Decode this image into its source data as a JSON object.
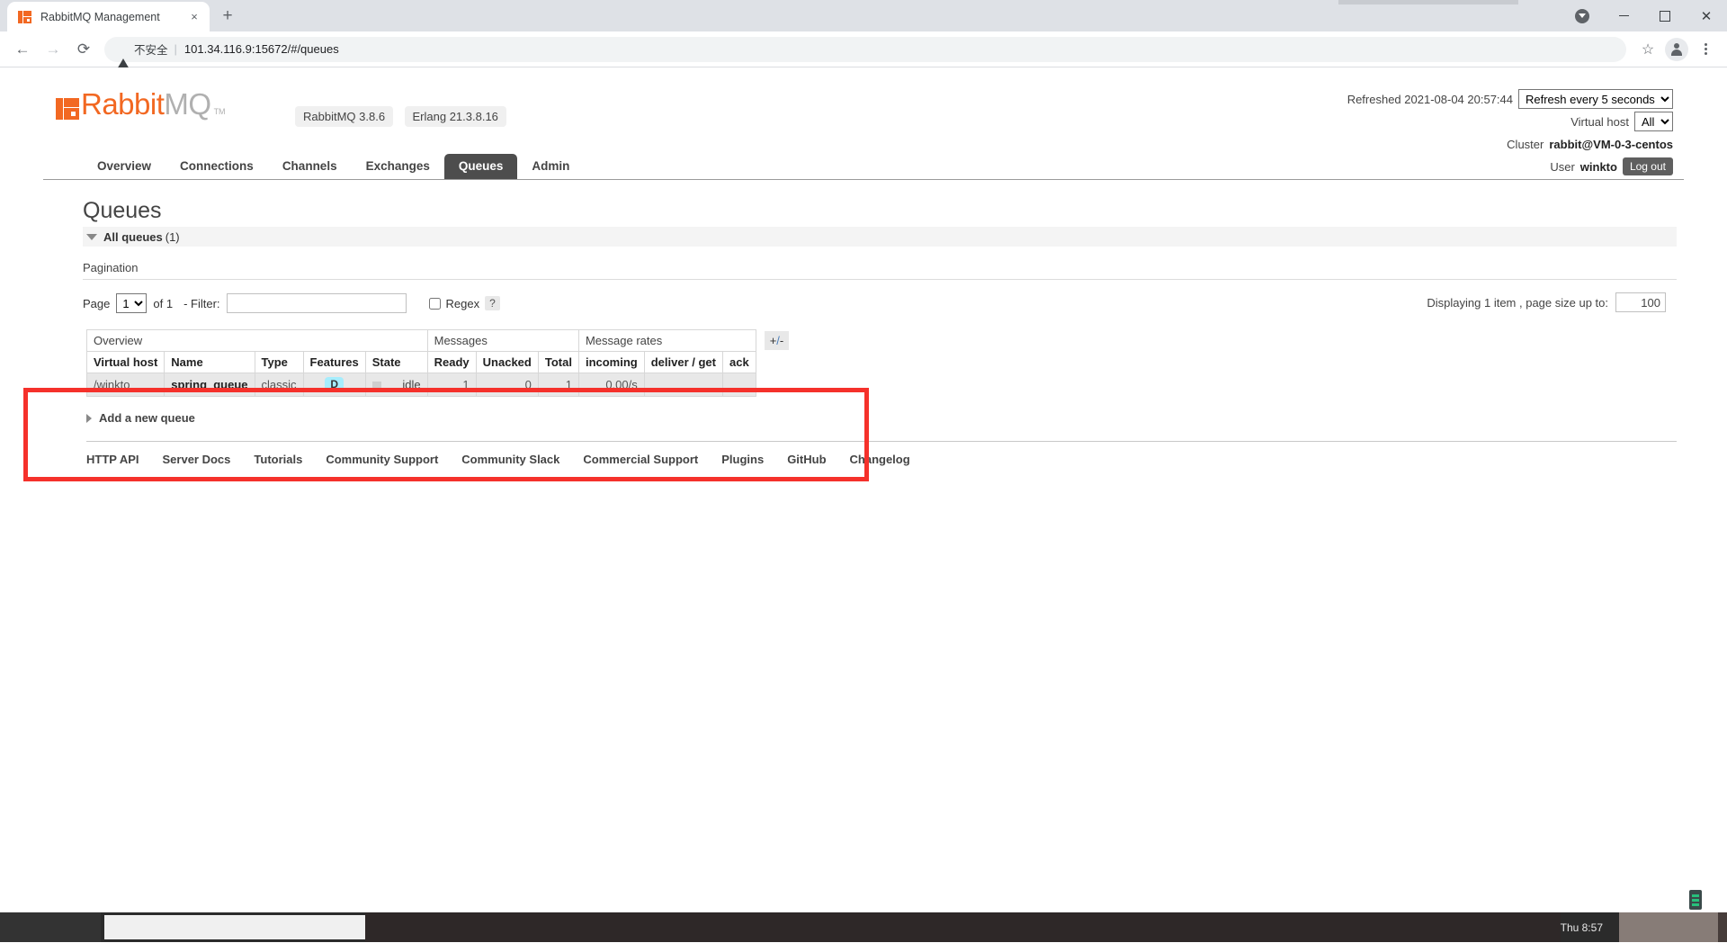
{
  "browser": {
    "tab_title": "RabbitMQ Management",
    "tab_close_label": "×",
    "new_tab_label": "+",
    "back_label": "←",
    "forward_label": "→",
    "reload_label": "⟳",
    "not_secure_text": "不安全",
    "url_separator": "|",
    "url": "101.34.116.9:15672/#/queues",
    "bookmark_label": "☆",
    "minimize_label": "—",
    "maximize_label": "❐",
    "close_label": "✕"
  },
  "header": {
    "logo_primary": "Rabbit",
    "logo_secondary": "MQ",
    "logo_tm": "TM",
    "versions": [
      "RabbitMQ 3.8.6",
      "Erlang 21.3.8.16"
    ],
    "refreshed_text": "Refreshed 2021-08-04 20:57:44",
    "refresh_select_value": "Refresh every 5 seconds",
    "refresh_options": [
      "Refresh every 5 seconds"
    ],
    "vhost_label": "Virtual host",
    "vhost_value": "All",
    "vhost_options": [
      "All"
    ],
    "cluster_label": "Cluster",
    "cluster_value": "rabbit@VM-0-3-centos",
    "user_label": "User",
    "user_value": "winkto",
    "logout_label": "Log out"
  },
  "nav": {
    "tabs": [
      {
        "label": "Overview",
        "active": false
      },
      {
        "label": "Connections",
        "active": false
      },
      {
        "label": "Channels",
        "active": false
      },
      {
        "label": "Exchanges",
        "active": false
      },
      {
        "label": "Queues",
        "active": true
      },
      {
        "label": "Admin",
        "active": false
      }
    ]
  },
  "main": {
    "page_title": "Queues",
    "all_queues_label": "All queues",
    "all_queues_count": "(1)",
    "pagination_label": "Pagination",
    "page_label": "Page",
    "page_value": "1",
    "page_options": [
      "1"
    ],
    "of_text": "of 1",
    "filter_label": "- Filter:",
    "filter_value": "",
    "filter_placeholder": "",
    "regex_label": "Regex",
    "regex_help": "?",
    "displaying_text": "Displaying 1 item , page size up to:",
    "page_size_value": "100",
    "plus_minus": {
      "plus": "+",
      "slash": "/",
      "minus": "-"
    },
    "add_queue_label": "Add a new queue"
  },
  "table": {
    "group_headers": [
      {
        "label": "Overview",
        "span": 5
      },
      {
        "label": "Messages",
        "span": 3
      },
      {
        "label": "Message rates",
        "span": 3
      }
    ],
    "columns": [
      "Virtual host",
      "Name",
      "Type",
      "Features",
      "State",
      "Ready",
      "Unacked",
      "Total",
      "incoming",
      "deliver / get",
      "ack"
    ],
    "rows": [
      {
        "vhost": "/winkto",
        "name": "spring_queue",
        "type": "classic",
        "features": "D",
        "state": "idle",
        "ready": "1",
        "unacked": "0",
        "total": "1",
        "incoming": "0.00/s",
        "deliver_get": "",
        "ack": ""
      }
    ]
  },
  "footer": {
    "links": [
      "HTTP API",
      "Server Docs",
      "Tutorials",
      "Community Support",
      "Community Slack",
      "Commercial Support",
      "Plugins",
      "GitHub",
      "Changelog"
    ]
  },
  "taskbar": {
    "clock": "Thu 8:57"
  },
  "colors": {
    "brand_orange": "#f26822",
    "highlight_red": "#f5312b",
    "feature_badge_bg": "#a6edfd",
    "active_tab_bg": "#4d4d4d"
  }
}
